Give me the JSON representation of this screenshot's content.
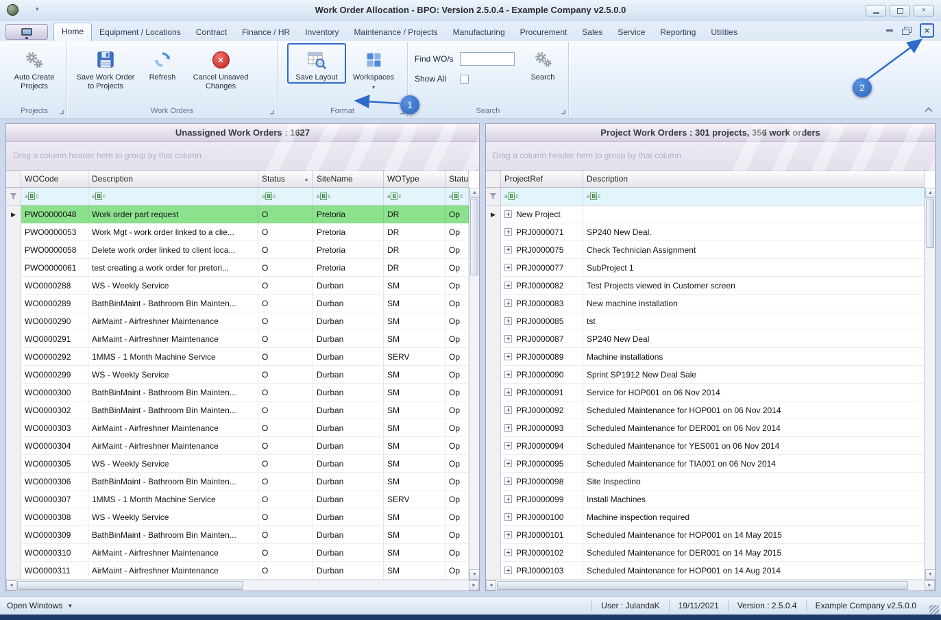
{
  "window": {
    "title": "Work Order Allocation - BPO: Version 2.5.0.4 - Example Company v2.5.0.0"
  },
  "glyphs": {
    "close": "×",
    "minimize": "–",
    "caret_down": "▼",
    "dropdown": "▾",
    "sort_asc": "▲",
    "row_marker": "▶",
    "up": "▲",
    "down": "▼",
    "left": "◄",
    "right": "►"
  },
  "ribbon": {
    "active_tab": "Home",
    "tabs": [
      "Home",
      "Equipment / Locations",
      "Contract",
      "Finance / HR",
      "Inventory",
      "Maintenance / Projects",
      "Manufacturing",
      "Procurement",
      "Sales",
      "Service",
      "Reporting",
      "Utilities"
    ],
    "buttons": {
      "auto_create_projects": "Auto Create Projects",
      "save_work_order": "Save Work Order to Projects",
      "refresh": "Refresh",
      "cancel_unsaved": "Cancel Unsaved Changes",
      "save_layout": "Save Layout",
      "workspaces": "Workspaces",
      "search": "Search"
    },
    "fields": {
      "find_label": "Find WO/s",
      "find_value": "",
      "show_all_label": "Show All",
      "show_all_checked": false
    },
    "groups": {
      "projects": "Projects",
      "work_orders": "Work Orders",
      "format": "Format",
      "search": "Search"
    }
  },
  "callouts": {
    "step1": "1",
    "step2": "2"
  },
  "left_panel": {
    "title": "Unassigned Work Orders : 1627",
    "group_hint": "Drag a column header here to group by that column",
    "columns": [
      {
        "label": "WOCode"
      },
      {
        "label": "Description"
      },
      {
        "label": "Status",
        "sort": "asc"
      },
      {
        "label": "SiteName"
      },
      {
        "label": "WOType"
      },
      {
        "label": "Status"
      }
    ],
    "rows": [
      {
        "cells": [
          "PWO0000048",
          "Work order part request",
          "O",
          "Pretoria",
          "DR",
          "Op"
        ],
        "selected": true,
        "marker": true
      },
      {
        "cells": [
          "PWO0000053",
          "Work Mgt - work order linked to a clie...",
          "O",
          "Pretoria",
          "DR",
          "Op"
        ]
      },
      {
        "cells": [
          "PWO0000058",
          "Delete work order linked to client loca...",
          "O",
          "Pretoria",
          "DR",
          "Op"
        ]
      },
      {
        "cells": [
          "PWO0000061",
          "test creating a work order for pretori...",
          "O",
          "Pretoria",
          "DR",
          "Op"
        ]
      },
      {
        "cells": [
          "WO0000288",
          "WS - Weekly Service",
          "O",
          "Durban",
          "SM",
          "Op"
        ]
      },
      {
        "cells": [
          "WO0000289",
          "BathBinMaint - Bathroom Bin Mainten...",
          "O",
          "Durban",
          "SM",
          "Op"
        ]
      },
      {
        "cells": [
          "WO0000290",
          "AirMaint - Airfreshner Maintenance",
          "O",
          "Durban",
          "SM",
          "Op"
        ]
      },
      {
        "cells": [
          "WO0000291",
          "AirMaint - Airfreshner Maintenance",
          "O",
          "Durban",
          "SM",
          "Op"
        ]
      },
      {
        "cells": [
          "WO0000292",
          "1MMS - 1 Month Machine Service",
          "O",
          "Durban",
          "SERV",
          "Op"
        ]
      },
      {
        "cells": [
          "WO0000299",
          "WS - Weekly Service",
          "O",
          "Durban",
          "SM",
          "Op"
        ]
      },
      {
        "cells": [
          "WO0000300",
          "BathBinMaint - Bathroom Bin Mainten...",
          "O",
          "Durban",
          "SM",
          "Op"
        ]
      },
      {
        "cells": [
          "WO0000302",
          "BathBinMaint - Bathroom Bin Mainten...",
          "O",
          "Durban",
          "SM",
          "Op"
        ]
      },
      {
        "cells": [
          "WO0000303",
          "AirMaint - Airfreshner Maintenance",
          "O",
          "Durban",
          "SM",
          "Op"
        ]
      },
      {
        "cells": [
          "WO0000304",
          "AirMaint - Airfreshner Maintenance",
          "O",
          "Durban",
          "SM",
          "Op"
        ]
      },
      {
        "cells": [
          "WO0000305",
          "WS - Weekly Service",
          "O",
          "Durban",
          "SM",
          "Op"
        ]
      },
      {
        "cells": [
          "WO0000306",
          "BathBinMaint - Bathroom Bin Mainten...",
          "O",
          "Durban",
          "SM",
          "Op"
        ]
      },
      {
        "cells": [
          "WO0000307",
          "1MMS - 1 Month Machine Service",
          "O",
          "Durban",
          "SERV",
          "Op"
        ]
      },
      {
        "cells": [
          "WO0000308",
          "WS - Weekly Service",
          "O",
          "Durban",
          "SM",
          "Op"
        ]
      },
      {
        "cells": [
          "WO0000309",
          "BathBinMaint - Bathroom Bin Mainten...",
          "O",
          "Durban",
          "SM",
          "Op"
        ]
      },
      {
        "cells": [
          "WO0000310",
          "AirMaint - Airfreshner Maintenance",
          "O",
          "Durban",
          "SM",
          "Op"
        ]
      },
      {
        "cells": [
          "WO0000311",
          "AirMaint - Airfreshner Maintenance",
          "O",
          "Durban",
          "SM",
          "Op"
        ]
      }
    ]
  },
  "right_panel": {
    "title": "Project Work Orders : 301 projects, 356 work orders",
    "group_hint": "Drag a column header here to group by that column",
    "columns": [
      {
        "label": "ProjectRef"
      },
      {
        "label": "Description"
      }
    ],
    "rows": [
      {
        "cells": [
          "New Project",
          ""
        ],
        "marker": true,
        "expand": true
      },
      {
        "cells": [
          "PRJ0000071",
          "SP240 New Deal."
        ],
        "expand": true
      },
      {
        "cells": [
          "PRJ0000075",
          "Check Technician Assignment"
        ],
        "expand": true
      },
      {
        "cells": [
          "PRJ0000077",
          "SubProject 1"
        ],
        "expand": true
      },
      {
        "cells": [
          "PRJ0000082",
          "Test Projects viewed in Customer screen"
        ],
        "expand": true
      },
      {
        "cells": [
          "PRJ0000083",
          "New machine installation"
        ],
        "expand": true
      },
      {
        "cells": [
          "PRJ0000085",
          "tst"
        ],
        "expand": true
      },
      {
        "cells": [
          "PRJ0000087",
          "SP240 New Deal"
        ],
        "expand": true
      },
      {
        "cells": [
          "PRJ0000089",
          "Machine installations"
        ],
        "expand": true
      },
      {
        "cells": [
          "PRJ0000090",
          "Sprint SP1912 New Deal Sale"
        ],
        "expand": true
      },
      {
        "cells": [
          "PRJ0000091",
          "Service for HOP001 on 06 Nov 2014"
        ],
        "expand": true
      },
      {
        "cells": [
          "PRJ0000092",
          "Scheduled Maintenance for HOP001 on 06 Nov 2014"
        ],
        "expand": true
      },
      {
        "cells": [
          "PRJ0000093",
          "Scheduled Maintenance for DER001 on 06 Nov 2014"
        ],
        "expand": true
      },
      {
        "cells": [
          "PRJ0000094",
          "Scheduled Maintenance for YES001 on 06 Nov 2014"
        ],
        "expand": true
      },
      {
        "cells": [
          "PRJ0000095",
          "Scheduled Maintenance for TIA001 on 06 Nov 2014"
        ],
        "expand": true
      },
      {
        "cells": [
          "PRJ0000098",
          "Site Inspectino"
        ],
        "expand": true
      },
      {
        "cells": [
          "PRJ0000099",
          "Install Machines"
        ],
        "expand": true
      },
      {
        "cells": [
          "PRJ0000100",
          "Machine inspection required"
        ],
        "expand": true
      },
      {
        "cells": [
          "PRJ0000101",
          "Scheduled Maintenance for HOP001 on 14 May 2015"
        ],
        "expand": true
      },
      {
        "cells": [
          "PRJ0000102",
          "Scheduled Maintenance for DER001 on 14 May 2015"
        ],
        "expand": true
      },
      {
        "cells": [
          "PRJ0000103",
          "Scheduled Maintenance for HOP001 on 14 Aug 2014"
        ],
        "expand": true
      }
    ]
  },
  "status_bar": {
    "open_windows": "Open Windows",
    "user": "User : JulandaK",
    "date": "19/11/2021",
    "version": "Version : 2.5.0.4",
    "company": "Example Company v2.5.0.0"
  }
}
